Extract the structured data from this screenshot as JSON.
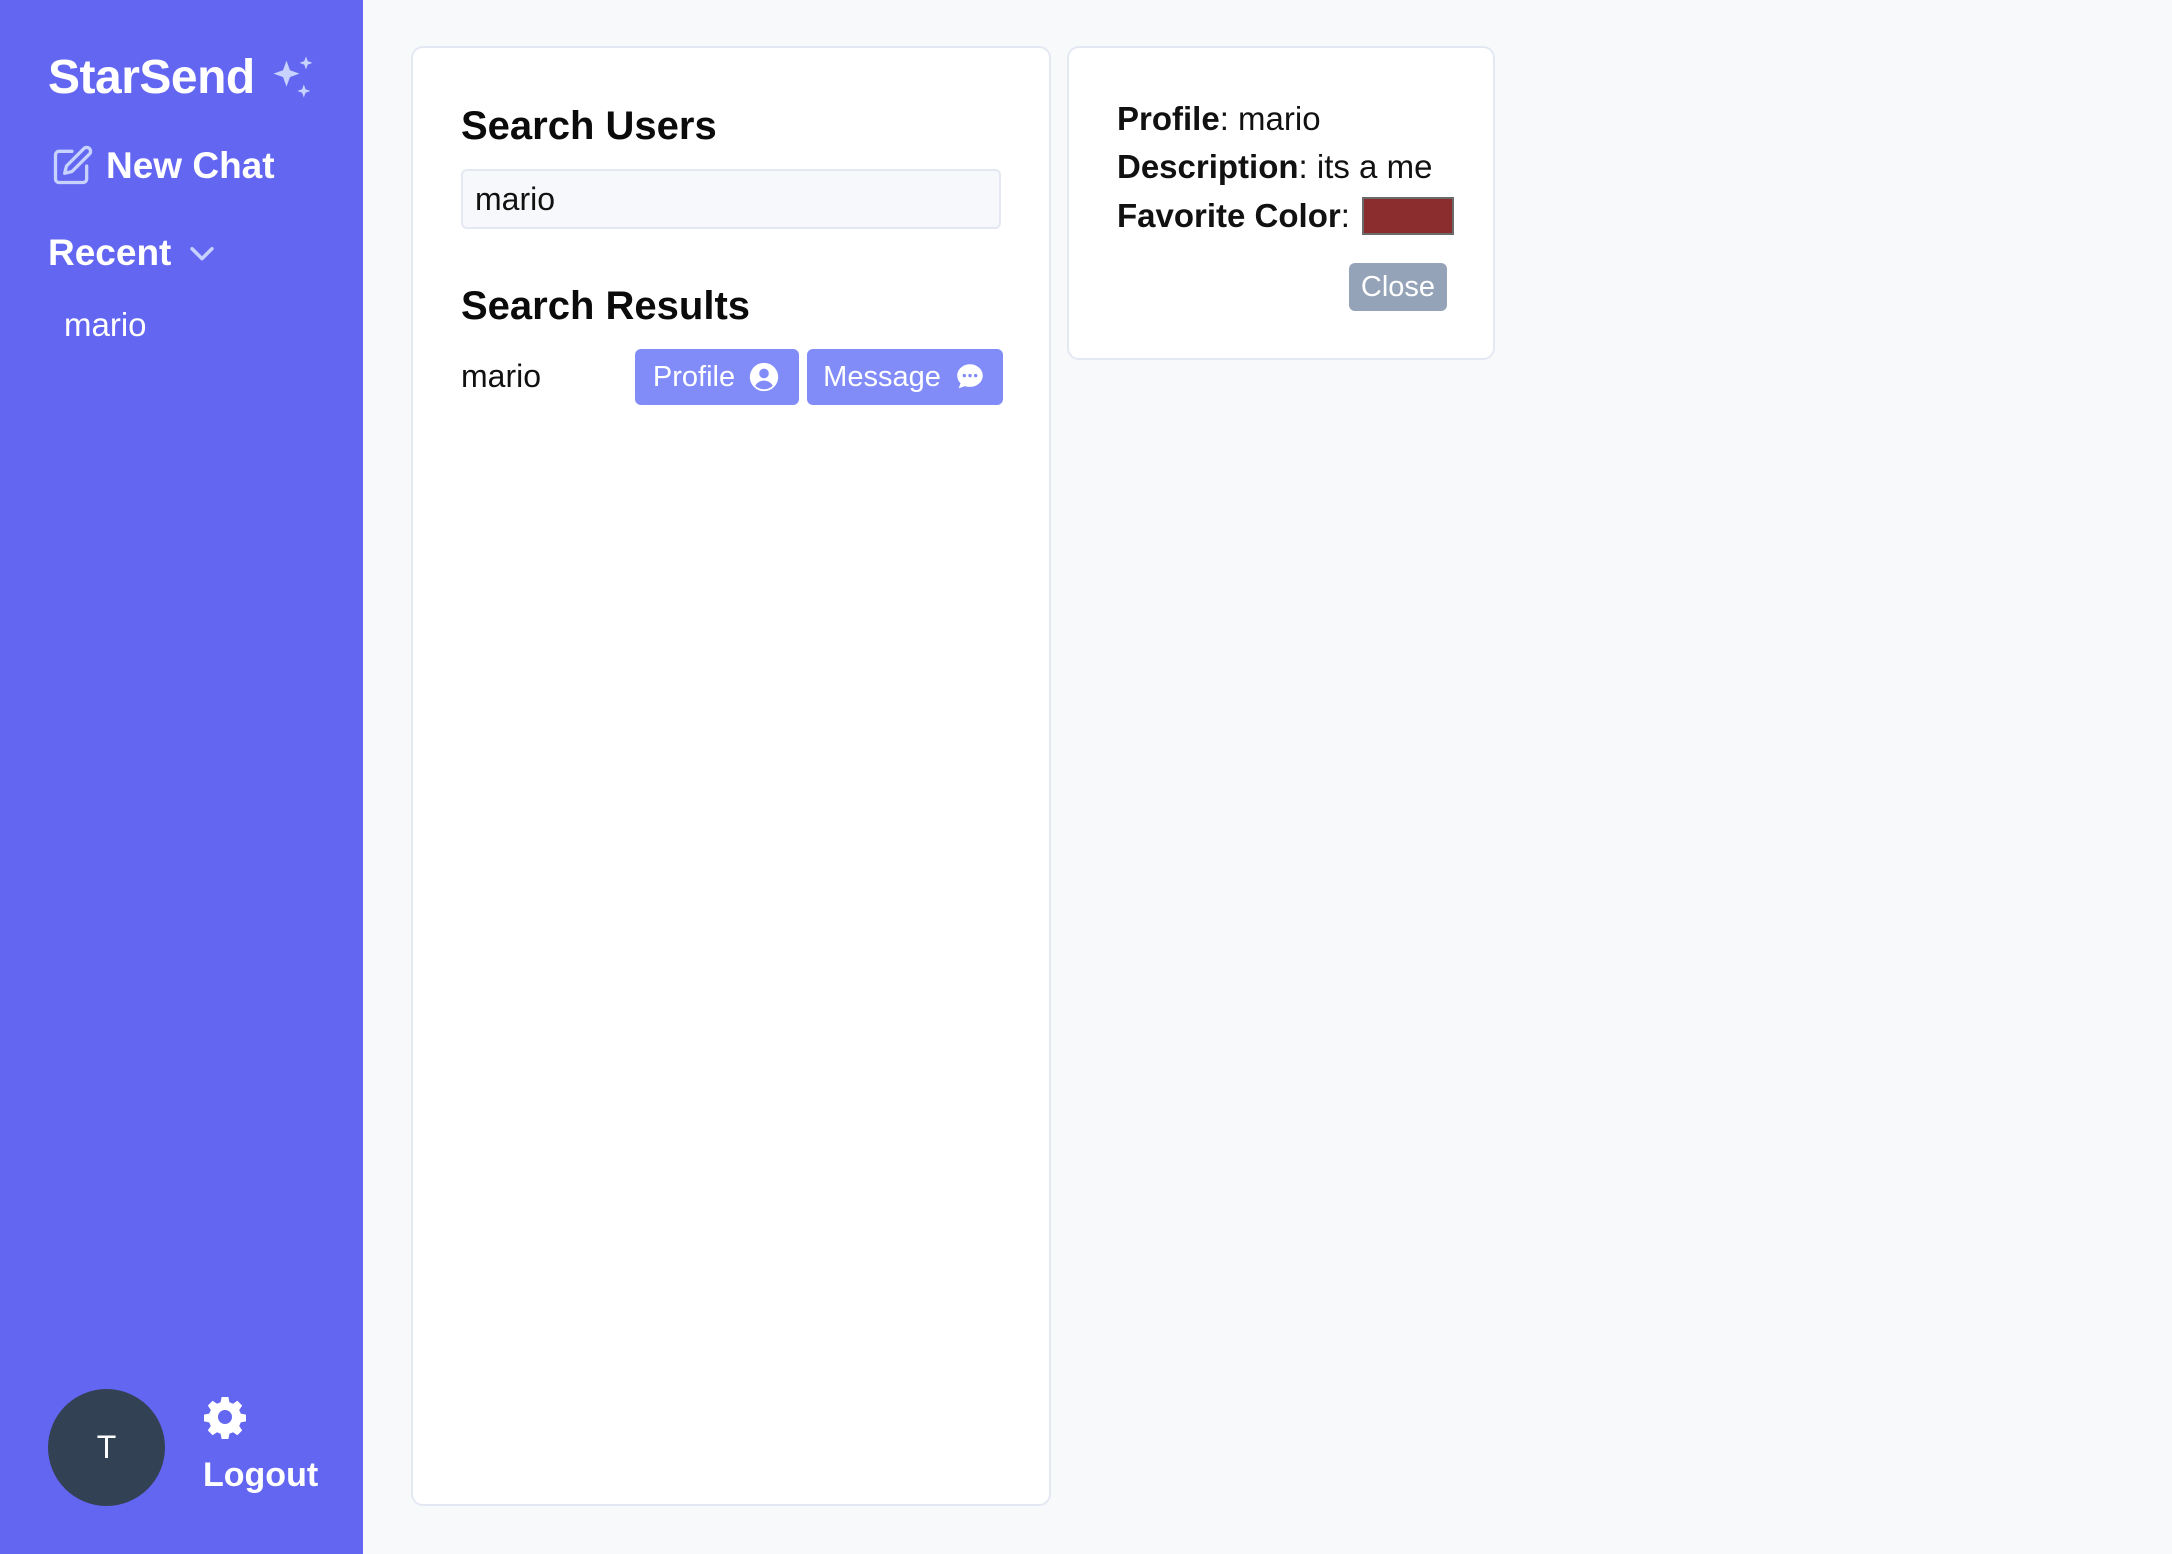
{
  "sidebar": {
    "brand": "StarSend",
    "new_chat": "New Chat",
    "recent_label": "Recent",
    "recent_items": [
      "mario"
    ],
    "avatar_initial": "T",
    "logout": "Logout",
    "bg_color": "#6366f1"
  },
  "search": {
    "title": "Search Users",
    "query": "mario",
    "results_title": "Search Results",
    "results": [
      {
        "name": "mario",
        "profile_label": "Profile",
        "message_label": "Message"
      }
    ]
  },
  "profile_panel": {
    "profile_label": "Profile",
    "profile_value": "mario",
    "description_label": "Description",
    "description_value": "its a me",
    "favorite_color_label": "Favorite Color",
    "favorite_color": "#8b2c2f",
    "close_label": "Close"
  },
  "icons": [
    "sparkles-icon",
    "edit-icon",
    "chevron-down-icon",
    "gear-icon",
    "user-circle-icon",
    "chat-bubble-icon"
  ]
}
